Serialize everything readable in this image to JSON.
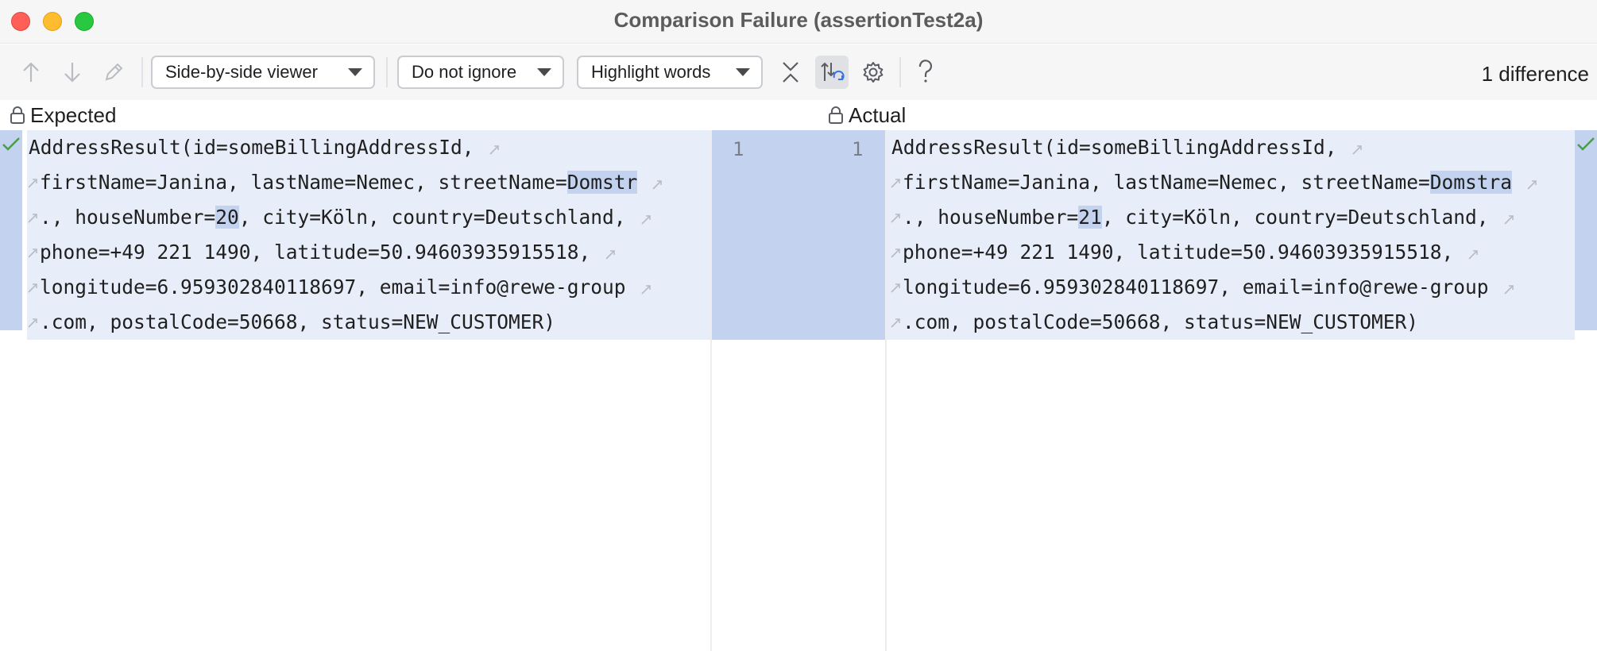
{
  "window": {
    "title": "Comparison Failure (assertionTest2a)"
  },
  "toolbar": {
    "viewer_label": "Side-by-side viewer",
    "ignore_label": "Do not ignore",
    "highlight_label": "Highlight words",
    "difference_count": "1 difference"
  },
  "icons": {
    "prev": "arrow-up-icon",
    "next": "arrow-down-icon",
    "edit": "pencil-icon",
    "collapse": "collapse-unchanged-icon",
    "sync_scroll": "sync-scroll-icon",
    "settings": "gear-icon",
    "help": "question-icon",
    "lock": "lock-icon",
    "check": "checkmark-icon",
    "wrap": "soft-wrap-icon"
  },
  "colors": {
    "changed_background": "#e8eef9",
    "highlight": "#c3d3ef",
    "check_green": "#4a9c4a"
  },
  "left": {
    "header": "Expected",
    "line_number": "1",
    "lines": [
      {
        "pre": "AddressResult(id=someBillingAddressId,",
        "hl": "",
        "post": ""
      },
      {
        "pre": "firstName=Janina, lastName=Nemec, streetName=",
        "hl": "Domstr",
        "post": ""
      },
      {
        "pre": "., houseNumber=",
        "hl": "20",
        "post": ", city=Köln, country=Deutschland,"
      },
      {
        "pre": "phone=+49 221 1490, latitude=50.94603935915518,",
        "hl": "",
        "post": ""
      },
      {
        "pre": "longitude=6.959302840118697, email=info@rewe-group",
        "hl": "",
        "post": ""
      },
      {
        "pre": ".com, postalCode=50668, status=NEW_CUSTOMER)",
        "hl": "",
        "post": ""
      }
    ]
  },
  "right": {
    "header": "Actual",
    "line_number": "1",
    "lines": [
      {
        "pre": "AddressResult(id=someBillingAddressId,",
        "hl": "",
        "post": ""
      },
      {
        "pre": "firstName=Janina, lastName=Nemec, streetName=",
        "hl": "Domstra",
        "post": ""
      },
      {
        "pre": "., houseNumber=",
        "hl": "21",
        "post": ", city=Köln, country=Deutschland,"
      },
      {
        "pre": "phone=+49 221 1490, latitude=50.94603935915518,",
        "hl": "",
        "post": ""
      },
      {
        "pre": "longitude=6.959302840118697, email=info@rewe-group",
        "hl": "",
        "post": ""
      },
      {
        "pre": ".com, postalCode=50668, status=NEW_CUSTOMER)",
        "hl": "",
        "post": ""
      }
    ]
  }
}
